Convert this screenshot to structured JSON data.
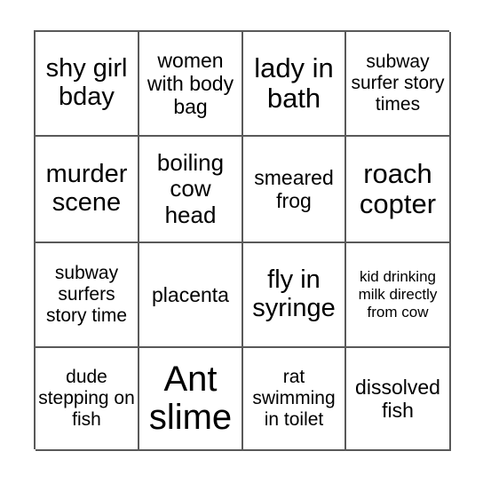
{
  "card": {
    "type": "bingo-card",
    "rows": 4,
    "columns": 4,
    "background_color": "#ffffff",
    "border_color": "#595959",
    "text_color": "#000000",
    "cells": [
      {
        "text": "shy girl bday",
        "size": "xl"
      },
      {
        "text": "women with body bag",
        "size": "md"
      },
      {
        "text": "lady in bath",
        "size": "xxl"
      },
      {
        "text": "subway surfer story times",
        "size": "sm"
      },
      {
        "text": "murder scene",
        "size": "xl"
      },
      {
        "text": "boiling cow head",
        "size": "lg"
      },
      {
        "text": "smeared frog",
        "size": "md"
      },
      {
        "text": "roach copter",
        "size": "xxl"
      },
      {
        "text": "subway surfers story time",
        "size": "sm"
      },
      {
        "text": "placenta",
        "size": "md"
      },
      {
        "text": "fly in syringe",
        "size": "xl"
      },
      {
        "text": "kid drinking milk directly from cow",
        "size": "xs"
      },
      {
        "text": "dude stepping on fish",
        "size": "sm"
      },
      {
        "text": "Ant slime",
        "size": "huge"
      },
      {
        "text": "rat swimming in toilet",
        "size": "sm"
      },
      {
        "text": "dissolved fish",
        "size": "md"
      }
    ]
  }
}
